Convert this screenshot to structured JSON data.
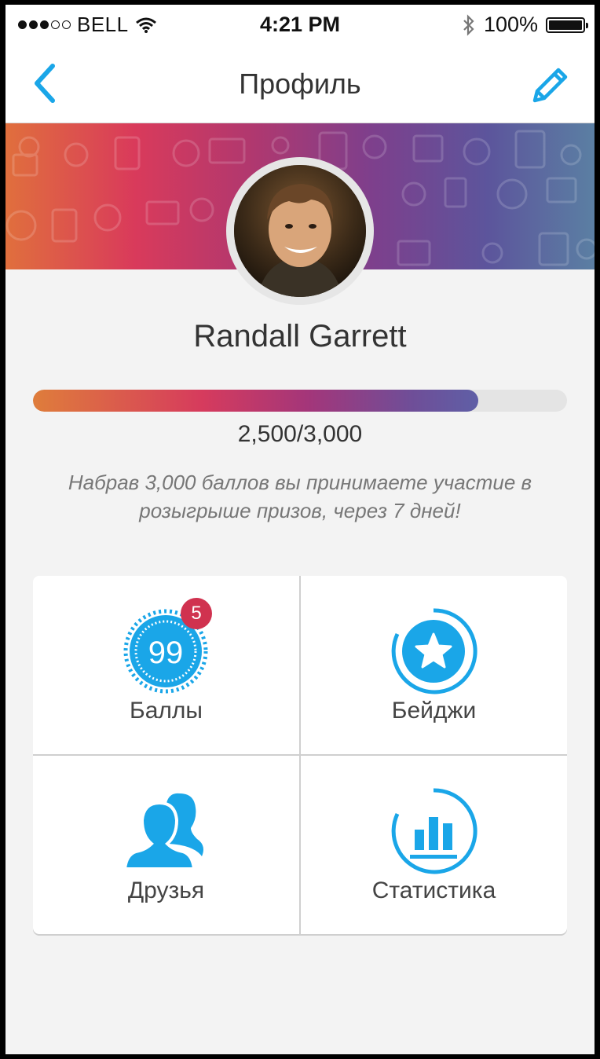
{
  "status_bar": {
    "carrier": "BELL",
    "time": "4:21 PM",
    "battery": "100%",
    "signal_bars": 3,
    "signal_total": 5
  },
  "nav": {
    "title": "Профиль",
    "back_icon": "chevron-left-icon",
    "edit_icon": "pencil-icon"
  },
  "profile": {
    "name": "Randall Garrett",
    "points_current": 2500,
    "points_goal": 3000,
    "progress_text": "2,500/3,000",
    "hint": "Набрав 3,000 баллов вы принимаете участие в розыгрыше призов, через 7 дней!"
  },
  "menu": [
    {
      "label": "Баллы",
      "icon": "points-99-icon",
      "icon_text": "99",
      "badge": "5"
    },
    {
      "label": "Бейджи",
      "icon": "star-badge-icon"
    },
    {
      "label": "Друзья",
      "icon": "friends-icon"
    },
    {
      "label": "Статистика",
      "icon": "statistics-icon"
    }
  ],
  "colors": {
    "accent": "#1aa6e8",
    "badge": "#d0324f",
    "gradient_start": "#e06f3d",
    "gradient_end": "#5b7fa3"
  }
}
